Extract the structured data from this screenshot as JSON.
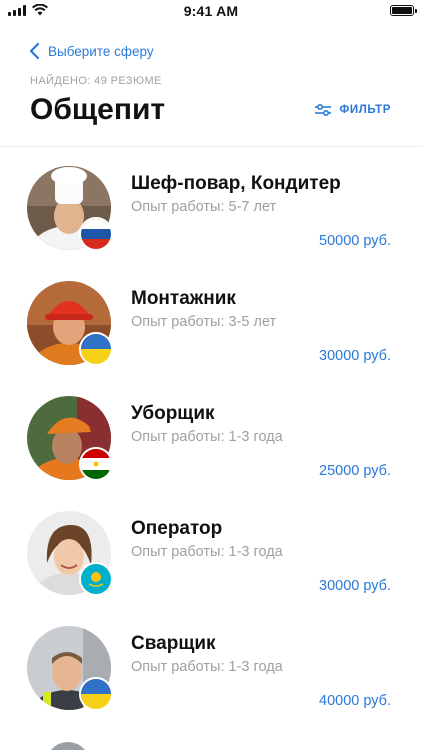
{
  "status": {
    "time": "9:41 AM"
  },
  "nav": {
    "back_label": "Выберите сферу"
  },
  "header": {
    "found_text": "НАЙДЕНО: 49 РЕЗЮМЕ",
    "title": "Общепит",
    "filter_label": "ФИЛЬТР"
  },
  "colors": {
    "accent": "#2a79d8",
    "muted": "#a0a0a0",
    "divider": "#ececec"
  },
  "items": [
    {
      "title": "Шеф-повар, Кондитер",
      "experience": "Опыт работы: 5-7 лет",
      "salary": "50000 руб.",
      "avatar": "chef-photo",
      "flag": "russia-flag"
    },
    {
      "title": "Монтажник",
      "experience": "Опыт работы: 3-5 лет",
      "salary": "30000 руб.",
      "avatar": "builder-photo",
      "flag": "ukraine-flag"
    },
    {
      "title": "Уборщик",
      "experience": "Опыт работы: 1-3 года",
      "salary": "25000 руб.",
      "avatar": "cleaner-photo",
      "flag": "tajikistan-flag"
    },
    {
      "title": "Оператор",
      "experience": "Опыт работы: 1-3 года",
      "salary": "30000 руб.",
      "avatar": "operator-photo",
      "flag": "kazakhstan-flag"
    },
    {
      "title": "Сварщик",
      "experience": "Опыт работы: 1-3 года",
      "salary": "40000 руб.",
      "avatar": "welder-photo",
      "flag": "ukraine-flag"
    }
  ]
}
